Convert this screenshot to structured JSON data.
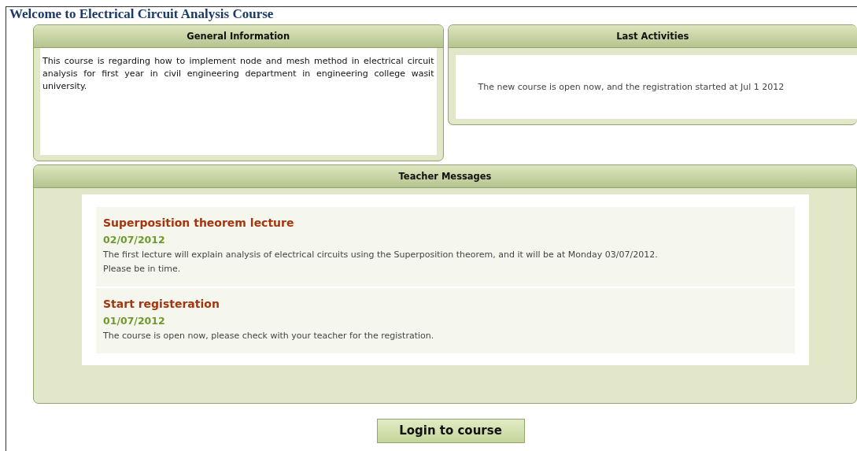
{
  "page_title": "Welcome to Electrical Circuit Analysis Course",
  "general_information": {
    "title": "General Information",
    "text": "This course is regarding how to implement node and mesh method in electrical circuit analysis for first year in civil engineering department in engineering college wasit university."
  },
  "last_activities": {
    "title": "Last Activities",
    "text": "The new course is open now, and the registration started at Jul 1 2012"
  },
  "teacher_messages": {
    "title": "Teacher Messages",
    "messages": [
      {
        "title": "Superposition theorem lecture",
        "date": "02/07/2012",
        "lines": [
          "The first lecture will explain analysis of electrical circuits using the Superposition theorem, and it will be at Monday 03/07/2012.",
          "Please be in time."
        ]
      },
      {
        "title": "Start registeration",
        "date": "01/07/2012",
        "lines": [
          "The course is open now, please check with your teacher for the registration."
        ]
      }
    ]
  },
  "login_button": "Login to course"
}
